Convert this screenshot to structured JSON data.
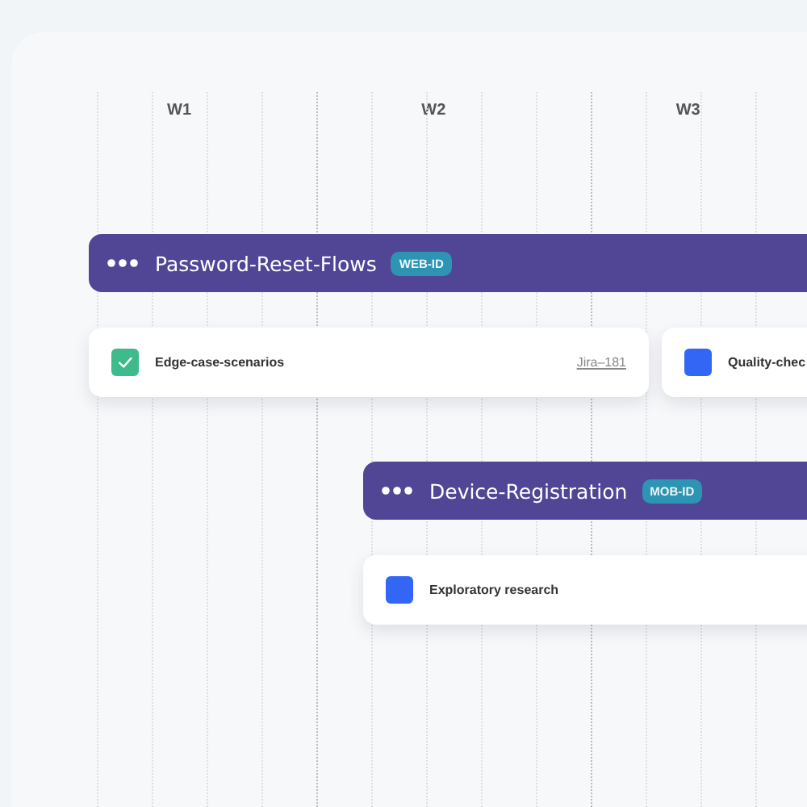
{
  "weeks": [
    "W1",
    "W2",
    "W3"
  ],
  "groups": [
    {
      "title": "Password-Reset-Flows",
      "tag": "WEB-ID",
      "tasks": [
        {
          "name": "Edge-case-scenarios",
          "checked": true,
          "color": "#3dbb8a",
          "link": "Jira–181"
        },
        {
          "name": "Quality-chec",
          "checked": false,
          "color": "#3366f5"
        }
      ]
    },
    {
      "title": "Device-Registration",
      "tag": "MOB-ID",
      "tasks": [
        {
          "name": "Exploratory research",
          "checked": false,
          "color": "#3366f5"
        }
      ]
    }
  ]
}
